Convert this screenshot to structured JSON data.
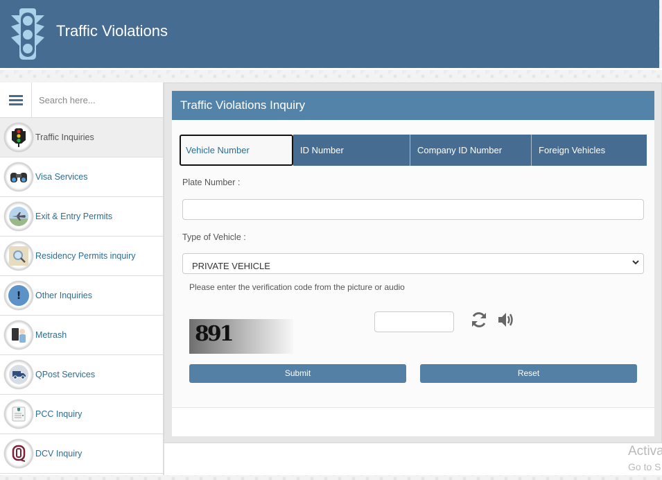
{
  "header": {
    "title": "Traffic Violations",
    "logo_icon": "traffic-light-icon",
    "background_color": "#466d91"
  },
  "sidebar": {
    "menu_icon": "hamburger-menu-icon",
    "search": {
      "placeholder": "Search here...",
      "value": ""
    },
    "items": [
      {
        "label": "Traffic Inquiries",
        "icon": "traffic-light-icon",
        "active": true
      },
      {
        "label": "Visa Services",
        "icon": "binoculars-icon",
        "active": false
      },
      {
        "label": "Exit & Entry Permits",
        "icon": "airplane-icon",
        "active": false
      },
      {
        "label": "Residency Permits inquiry",
        "icon": "magnifier-document-icon",
        "active": false
      },
      {
        "label": "Other Inquiries",
        "icon": "exclamation-bubble-icon",
        "active": false
      },
      {
        "label": "Metrash",
        "icon": "metrash-icon",
        "active": false
      },
      {
        "label": "QPost Services",
        "icon": "delivery-van-icon",
        "active": false
      },
      {
        "label": "PCC Inquiry",
        "icon": "certificate-icon",
        "active": false
      },
      {
        "label": "DCV Inquiry",
        "icon": "dcv-logo-icon",
        "active": false
      }
    ]
  },
  "main": {
    "panel_title": "Traffic Violations Inquiry",
    "tabs": [
      {
        "label": "Vehicle Number",
        "active": true
      },
      {
        "label": "ID Number",
        "active": false
      },
      {
        "label": "Company ID Number",
        "active": false
      },
      {
        "label": "Foreign Vehicles",
        "active": false
      }
    ],
    "form": {
      "plate_number_label": "Plate Number :",
      "plate_number_value": "",
      "vehicle_type_label": "Type of Vehicle :",
      "vehicle_type_selected": "PRIVATE VEHICLE",
      "captcha_instruction": "Please enter the verification code from the picture or audio",
      "captcha_code_image_text": "891",
      "captcha_input_value": "",
      "refresh_icon": "refresh-icon",
      "audio_icon": "speaker-icon",
      "submit_label": "Submit",
      "reset_label": "Reset"
    }
  },
  "watermark": {
    "line1": "Activa",
    "line2": "Go to S"
  }
}
